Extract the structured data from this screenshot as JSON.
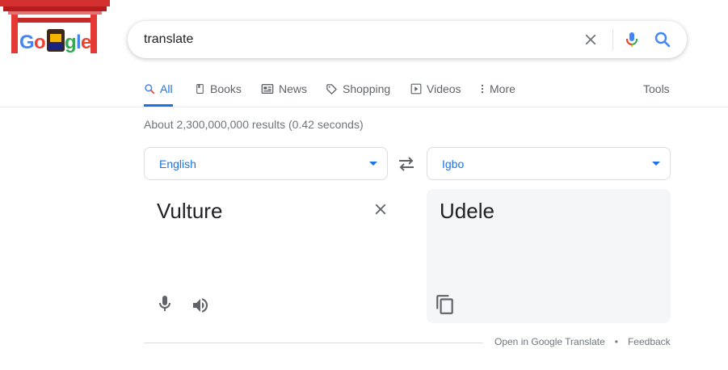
{
  "logo": {
    "text": "Google"
  },
  "search": {
    "query": "translate",
    "placeholder": ""
  },
  "tabs": [
    {
      "label": "All",
      "icon": "search-icon",
      "active": true
    },
    {
      "label": "Books",
      "icon": "book-icon"
    },
    {
      "label": "News",
      "icon": "news-icon"
    },
    {
      "label": "Shopping",
      "icon": "tag-icon"
    },
    {
      "label": "Videos",
      "icon": "play-icon"
    },
    {
      "label": "More",
      "icon": "more-vert-icon"
    }
  ],
  "tools_label": "Tools",
  "result_stats": "About 2,300,000,000 results (0.42 seconds)",
  "translate": {
    "source_language": "English",
    "target_language": "Igbo",
    "source_text": "Vulture",
    "target_text": "Udele"
  },
  "footer": {
    "open_link": "Open in Google Translate",
    "separator": "•",
    "feedback_link": "Feedback"
  },
  "colors": {
    "accent": "#1a73e8",
    "text": "#202124",
    "secondary_text": "#70757a",
    "target_pane_bg": "#f5f6f8"
  }
}
